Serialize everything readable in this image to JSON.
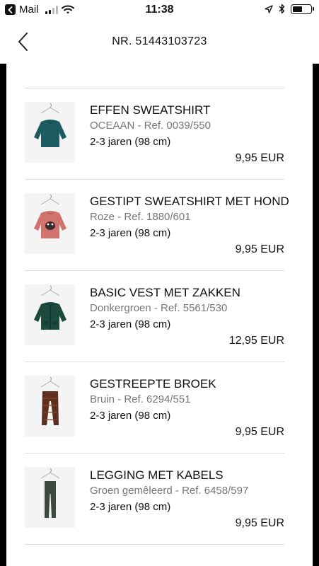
{
  "status_bar": {
    "back_app": "Mail",
    "time": "11:38",
    "battery_level": 0.55
  },
  "header": {
    "title": "NR. 51443103723"
  },
  "items": [
    {
      "name": "EFFEN SWEATSHIRT",
      "ref": "OCEAAN - Ref. 0039/550",
      "size": "2-3 jaren (98 cm)",
      "price": "9,95 EUR",
      "garment": "sweatshirt",
      "color": "#1d5b63"
    },
    {
      "name": "GESTIPT SWEATSHIRT MET HOND",
      "ref": "Roze - Ref. 1880/601",
      "size": "2-3 jaren (98 cm)",
      "price": "9,95 EUR",
      "garment": "sweatshirt-print",
      "color": "#d1726c"
    },
    {
      "name": "BASIC VEST MET ZAKKEN",
      "ref": "Donkergroen - Ref. 5561/530",
      "size": "2-3 jaren (98 cm)",
      "price": "12,95 EUR",
      "garment": "cardigan",
      "color": "#1d4a3f"
    },
    {
      "name": "GESTREEPTE BROEK",
      "ref": "Bruin - Ref. 6294/551",
      "size": "2-3 jaren (98 cm)",
      "price": "9,95 EUR",
      "garment": "trousers",
      "color": "#5e2f1f"
    },
    {
      "name": "LEGGING MET KABELS",
      "ref": "Groen gemêleerd - Ref. 6458/597",
      "size": "2-3 jaren (98 cm)",
      "price": "9,95 EUR",
      "garment": "leggings",
      "color": "#3c4a3e"
    }
  ]
}
